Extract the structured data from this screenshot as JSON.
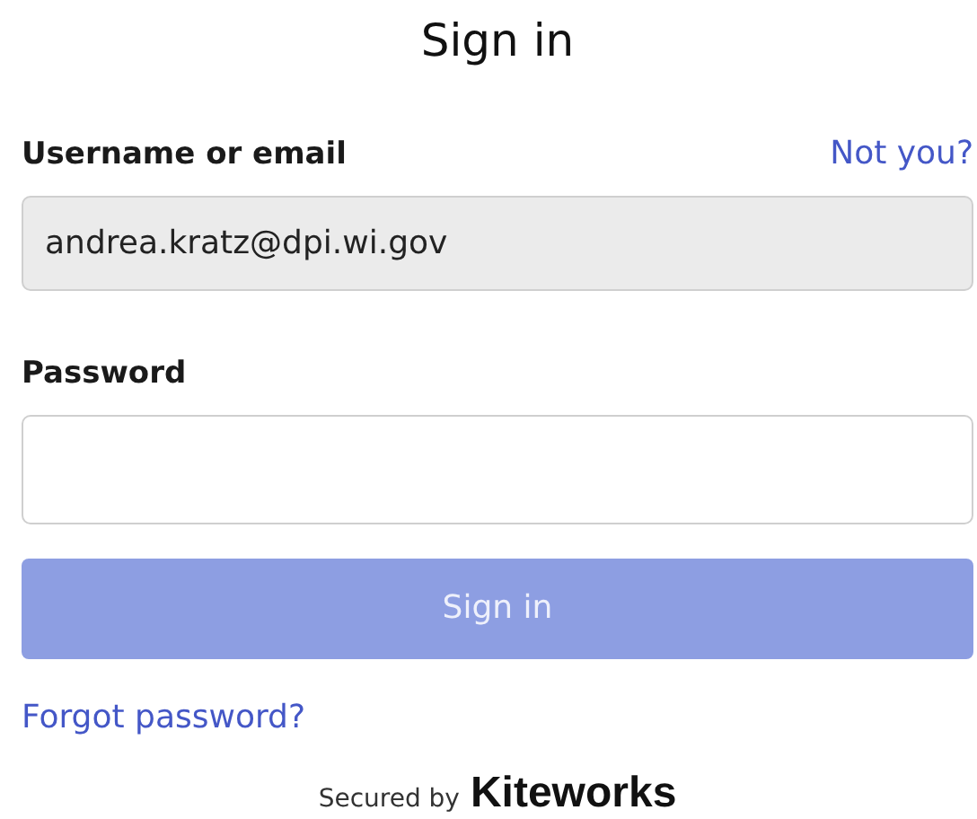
{
  "title": "Sign in",
  "username": {
    "label": "Username or email",
    "link": "Not you?",
    "value": "andrea.kratz@dpi.wi.gov",
    "disabled": true
  },
  "password": {
    "label": "Password",
    "disabled": false
  },
  "submit": {
    "label": "Sign in",
    "disabled": true
  },
  "forgot": "Forgot password?",
  "footer": {
    "prefix": "Secured by",
    "brand": "Kiteworks"
  }
}
